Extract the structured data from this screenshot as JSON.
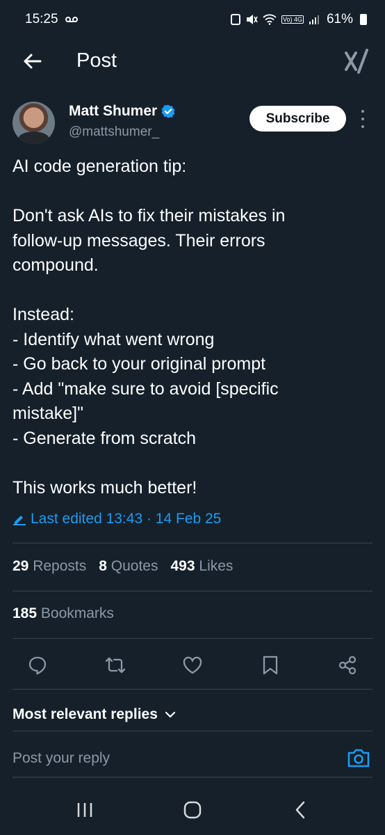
{
  "status_bar": {
    "time": "15:25",
    "battery": "61%",
    "network": "Vo) 4G"
  },
  "header": {
    "title": "Post"
  },
  "author": {
    "name": "Matt Shumer",
    "handle": "@mattshumer_"
  },
  "subscribe_label": "Subscribe",
  "post": {
    "lines": [
      "AI code generation tip:",
      "Don't ask AIs to fix their mistakes in follow-up messages. Their errors compound.",
      "Instead:\n- Identify what went wrong\n- Go back to your original prompt\n- Add \"make sure to avoid [specific mistake]\"\n- Generate from scratch",
      "This works much better!"
    ]
  },
  "edited": {
    "label": "Last edited 13:43 · 14 Feb 25"
  },
  "stats": {
    "reposts": {
      "count": "29",
      "label": "Reposts"
    },
    "quotes": {
      "count": "8",
      "label": "Quotes"
    },
    "likes": {
      "count": "493",
      "label": "Likes"
    },
    "bookmarks": {
      "count": "185",
      "label": "Bookmarks"
    }
  },
  "replies": {
    "sort_label": "Most relevant replies",
    "placeholder": "Post your reply"
  },
  "colors": {
    "background": "#15202b",
    "accent": "#1d9bf0",
    "muted": "#8b98a5",
    "divider": "#38444d"
  },
  "icons": {
    "actions": [
      "reply-icon",
      "repost-icon",
      "like-icon",
      "bookmark-icon",
      "share-icon"
    ],
    "nav": [
      "recents-icon",
      "home-icon",
      "back-nav-icon"
    ]
  }
}
